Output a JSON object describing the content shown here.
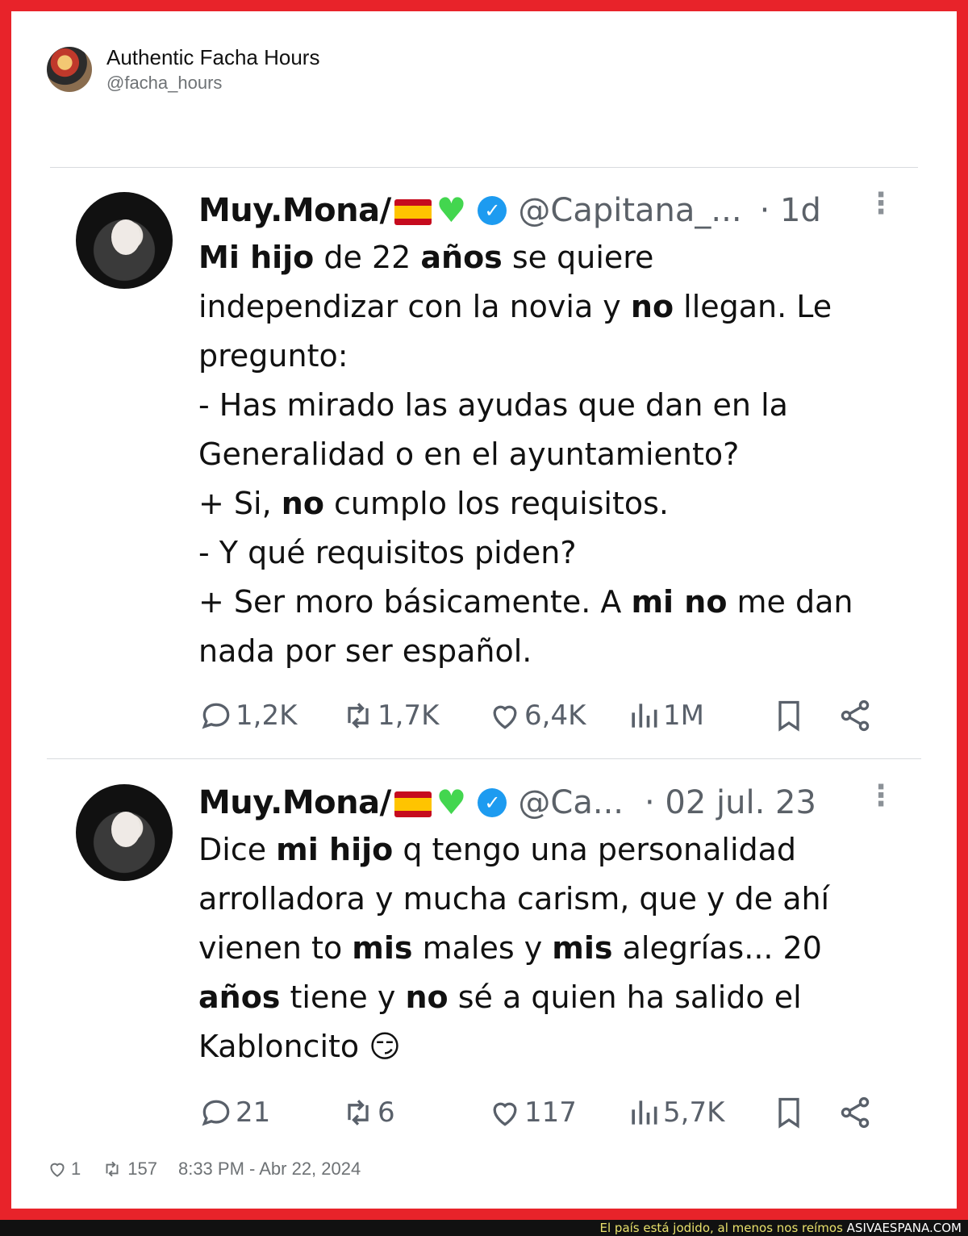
{
  "quoter": {
    "name": "Authentic Facha Hours",
    "handle": "@facha_hours"
  },
  "tweets": [
    {
      "name": "Muy.Mona/",
      "handle": "@Capitana_...",
      "time": "· 1d",
      "more": "⋮",
      "lines": [
        [
          {
            "t": "Mi hijo",
            "b": true
          },
          {
            "t": " de 22 "
          },
          {
            "t": "años",
            "b": true
          },
          {
            "t": " se quiere"
          }
        ],
        [
          {
            "t": "independizar con la novia y "
          },
          {
            "t": "no",
            "b": true
          },
          {
            "t": " llegan. Le"
          }
        ],
        [
          {
            "t": "pregunto:"
          }
        ],
        [
          {
            "t": "- Has mirado las ayudas que dan en la"
          }
        ],
        [
          {
            "t": "Generalidad o en el ayuntamiento?"
          }
        ],
        [
          {
            "t": "+ Si, "
          },
          {
            "t": "no",
            "b": true
          },
          {
            "t": " cumplo los requisitos."
          }
        ],
        [
          {
            "t": "- Y qué requisitos piden?"
          }
        ],
        [
          {
            "t": "+ Ser moro básicamente. A "
          },
          {
            "t": "mi no",
            "b": true
          },
          {
            "t": " me dan"
          }
        ],
        [
          {
            "t": "nada por ser español."
          }
        ]
      ],
      "replies": "1,2K",
      "retweets": "1,7K",
      "likes": "6,4K",
      "views": "1M"
    },
    {
      "name": "Muy.Mona/",
      "handle": "@Ca...",
      "time": "· 02 jul. 23",
      "more": "⋮",
      "lines": [
        [
          {
            "t": "Dice "
          },
          {
            "t": "mi hijo",
            "b": true
          },
          {
            "t": " q tengo una personalidad"
          }
        ],
        [
          {
            "t": "arrolladora y mucha carism, que y de ahí"
          }
        ],
        [
          {
            "t": "vienen to "
          },
          {
            "t": "mis",
            "b": true
          },
          {
            "t": " males y "
          },
          {
            "t": "mis",
            "b": true
          },
          {
            "t": " alegrías... 20"
          }
        ],
        [
          {
            "t": "años",
            "b": true
          },
          {
            "t": " tiene y "
          },
          {
            "t": "no",
            "b": true
          },
          {
            "t": " sé a quien ha salido el"
          }
        ],
        [
          {
            "t": "Kabloncito 😏"
          }
        ]
      ],
      "replies": "21",
      "retweets": "6",
      "likes": "117",
      "views": "5,7K"
    }
  ],
  "meta": {
    "likes": "1",
    "retweets": "157",
    "timestamp": "8:33 PM - Abr 22, 2024"
  },
  "footer": {
    "tagline": "El país está jodido, al menos nos reímos",
    "site": "ASIVAESPANA.COM"
  },
  "colors": {
    "frame": "#e8232a",
    "verified": "#1d9bf0",
    "muted": "#5b6168"
  }
}
